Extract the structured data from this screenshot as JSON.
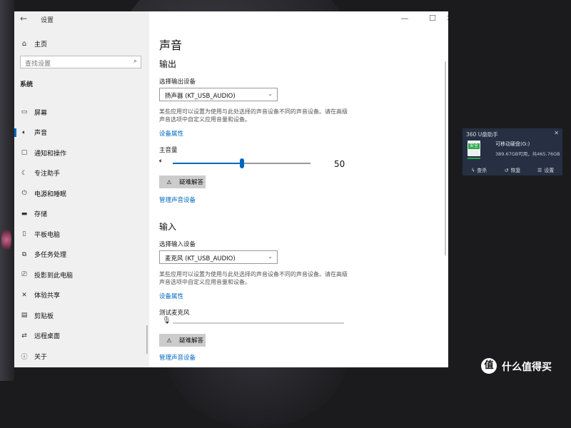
{
  "window": {
    "back_icon": "←",
    "title": "设置",
    "controls": {
      "minimize": "—",
      "maximize": "☐",
      "close": "✕"
    }
  },
  "sidebar": {
    "home": {
      "icon": "home-icon",
      "label": "主页"
    },
    "search": {
      "placeholder": "查找设置"
    },
    "section": "系统",
    "items": [
      {
        "icon": "monitor-icon",
        "label": "屏幕"
      },
      {
        "icon": "speaker-icon",
        "label": "声音",
        "active": true
      },
      {
        "icon": "notification-icon",
        "label": "通知和操作"
      },
      {
        "icon": "focus-assist-icon",
        "label": "专注助手"
      },
      {
        "icon": "power-icon",
        "label": "电源和睡眠"
      },
      {
        "icon": "storage-icon",
        "label": "存储"
      },
      {
        "icon": "tablet-icon",
        "label": "平板电脑"
      },
      {
        "icon": "multitasking-icon",
        "label": "多任务处理"
      },
      {
        "icon": "projecting-icon",
        "label": "投影到此电脑"
      },
      {
        "icon": "shared-experiences-icon",
        "label": "体验共享"
      },
      {
        "icon": "clipboard-icon",
        "label": "剪贴板"
      },
      {
        "icon": "remote-desktop-icon",
        "label": "远程桌面"
      },
      {
        "icon": "info-icon",
        "label": "关于"
      }
    ]
  },
  "main": {
    "title": "声音",
    "output": {
      "heading": "输出",
      "device_label": "选择输出设备",
      "device_value": "扬声器 (KT_USB_AUDIO)",
      "description": "某些应用可以设置为使用与此处选择的声音设备不同的声音设备。请在高级声音选项中自定义应用音量和设备。",
      "device_properties_link": "设备属性",
      "master_volume_label": "主音量",
      "volume": "50",
      "troubleshoot_label": "疑难解答",
      "manage_link": "管理声音设备"
    },
    "input": {
      "heading": "输入",
      "device_label": "选择输入设备",
      "device_value": "麦克风 (KT_USB_AUDIO)",
      "description": "某些应用可以设置为使用与此处选择的声音设备不同的声音设备。请在高级声音选项中自定义应用音量和设备。",
      "device_properties_link": "设备属性",
      "test_mic_label": "测试麦克风",
      "troubleshoot_label": "疑难解答",
      "manage_link": "管理声音设备"
    }
  },
  "widget_360": {
    "title": "360 U盘助手",
    "badge": "安全",
    "drive_name": "可移动硬盘(G:)",
    "space": "389.67GB可用，共465.76GB",
    "actions": [
      {
        "icon": "lightning-icon",
        "label": "查杀"
      },
      {
        "icon": "restore-icon",
        "label": "恢复"
      },
      {
        "icon": "settings-icon",
        "label": "设置"
      }
    ]
  },
  "watermark": {
    "logo": "值",
    "text": "什么值得买"
  },
  "colors": {
    "accent": "#0067c0",
    "sidebar_bg": "#f0f0f0",
    "widget_bg": "#263042",
    "safe_green": "#2aa94c"
  }
}
